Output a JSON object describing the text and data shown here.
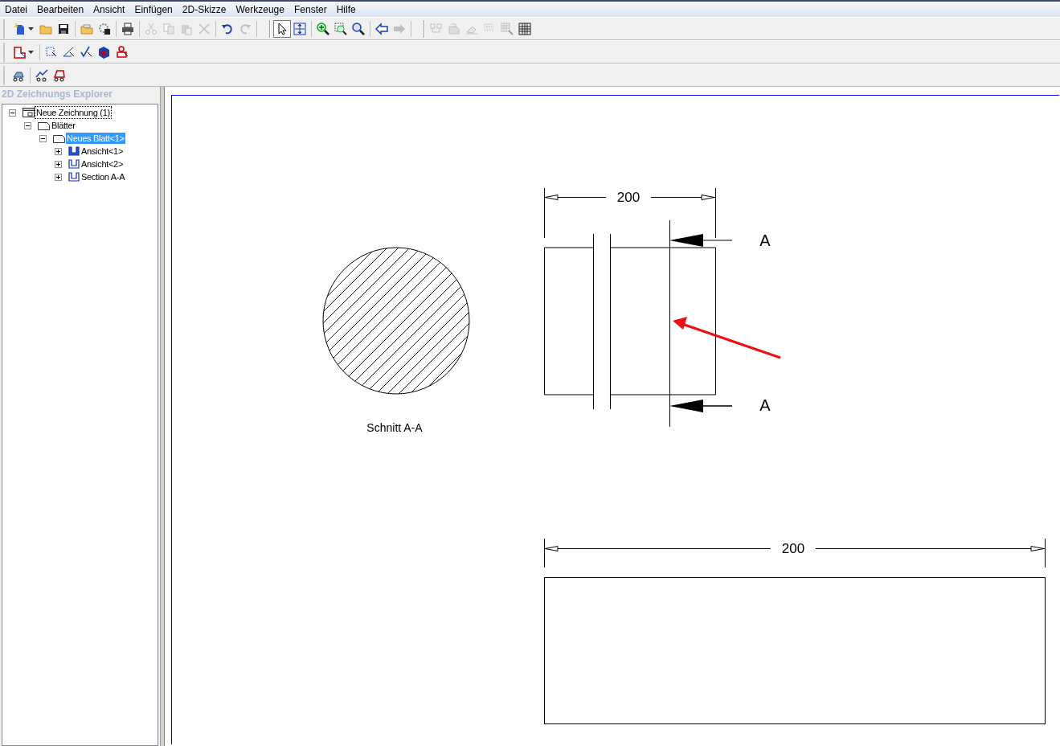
{
  "menu": [
    "Datei",
    "Bearbeiten",
    "Ansicht",
    "Einfügen",
    "2D-Skizze",
    "Werkzeuge",
    "Fenster",
    "Hilfe"
  ],
  "toolbars": [
    {
      "groups": [
        [
          {
            "disabled": false,
            "active": false
          },
          {
            "disabled": false,
            "active": false
          },
          {
            "disabled": false,
            "active": false
          }
        ],
        [
          {
            "disabled": false,
            "active": false
          },
          {
            "disabled": false,
            "active": false
          }
        ],
        [
          {
            "disabled": false,
            "active": false
          }
        ],
        [
          {
            "disabled": true,
            "active": false
          },
          {
            "disabled": true,
            "active": false
          },
          {
            "disabled": true,
            "active": false
          },
          {
            "disabled": true,
            "active": false
          }
        ],
        [
          {
            "disabled": false,
            "active": false
          },
          {
            "disabled": true,
            "active": false
          }
        ],
        [
          {
            "disabled": false,
            "active": true
          },
          {
            "disabled": false,
            "active": false
          }
        ],
        [
          {
            "disabled": false,
            "active": false
          },
          {
            "disabled": false,
            "active": false
          },
          {
            "disabled": false,
            "active": false
          }
        ],
        [
          {
            "disabled": false,
            "active": false
          },
          {
            "disabled": true,
            "active": false
          }
        ],
        [
          {
            "disabled": true,
            "active": false
          },
          {
            "disabled": true,
            "active": false
          },
          {
            "disabled": true,
            "active": false
          },
          {
            "disabled": true,
            "active": false
          },
          {
            "disabled": true,
            "active": false
          },
          {
            "disabled": false,
            "active": false
          }
        ]
      ]
    },
    {
      "groups": [
        [
          {
            "disabled": false,
            "active": false
          }
        ],
        [
          {
            "disabled": false,
            "active": false
          },
          {
            "disabled": false,
            "active": false
          },
          {
            "disabled": false,
            "active": false
          },
          {
            "disabled": false,
            "active": false
          },
          {
            "disabled": false,
            "active": false
          }
        ]
      ]
    },
    {
      "groups": [
        [
          {
            "disabled": false,
            "active": false
          }
        ],
        [
          {
            "disabled": false,
            "active": false
          },
          {
            "disabled": false,
            "active": false
          }
        ]
      ]
    }
  ],
  "explorer": {
    "title": "2D Zeichnungs Explorer",
    "tree": [
      {
        "label": "Neue Zeichnung (1)",
        "kind": "drawing",
        "expanded": true,
        "selected": false,
        "focused": true,
        "children": [
          {
            "label": "Blätter",
            "kind": "sheet",
            "expanded": true,
            "selected": false,
            "focused": false,
            "children": [
              {
                "label": "Neues Blatt<1>",
                "kind": "sheet",
                "expanded": true,
                "selected": true,
                "focused": false,
                "children": [
                  {
                    "label": "Ansicht<1>",
                    "kind": "view_filled",
                    "expanded": false,
                    "selected": false,
                    "focused": false
                  },
                  {
                    "label": "Ansicht<2>",
                    "kind": "view",
                    "expanded": false,
                    "selected": false,
                    "focused": false
                  },
                  {
                    "label": "Section A-A",
                    "kind": "view",
                    "expanded": false,
                    "selected": false,
                    "focused": false
                  }
                ]
              }
            ]
          }
        ]
      }
    ]
  },
  "drawing": {
    "section_caption": "Schnitt A-A",
    "top_dimension": "200",
    "section_labels": [
      "A",
      "A"
    ],
    "bottom_dimension": "200"
  }
}
